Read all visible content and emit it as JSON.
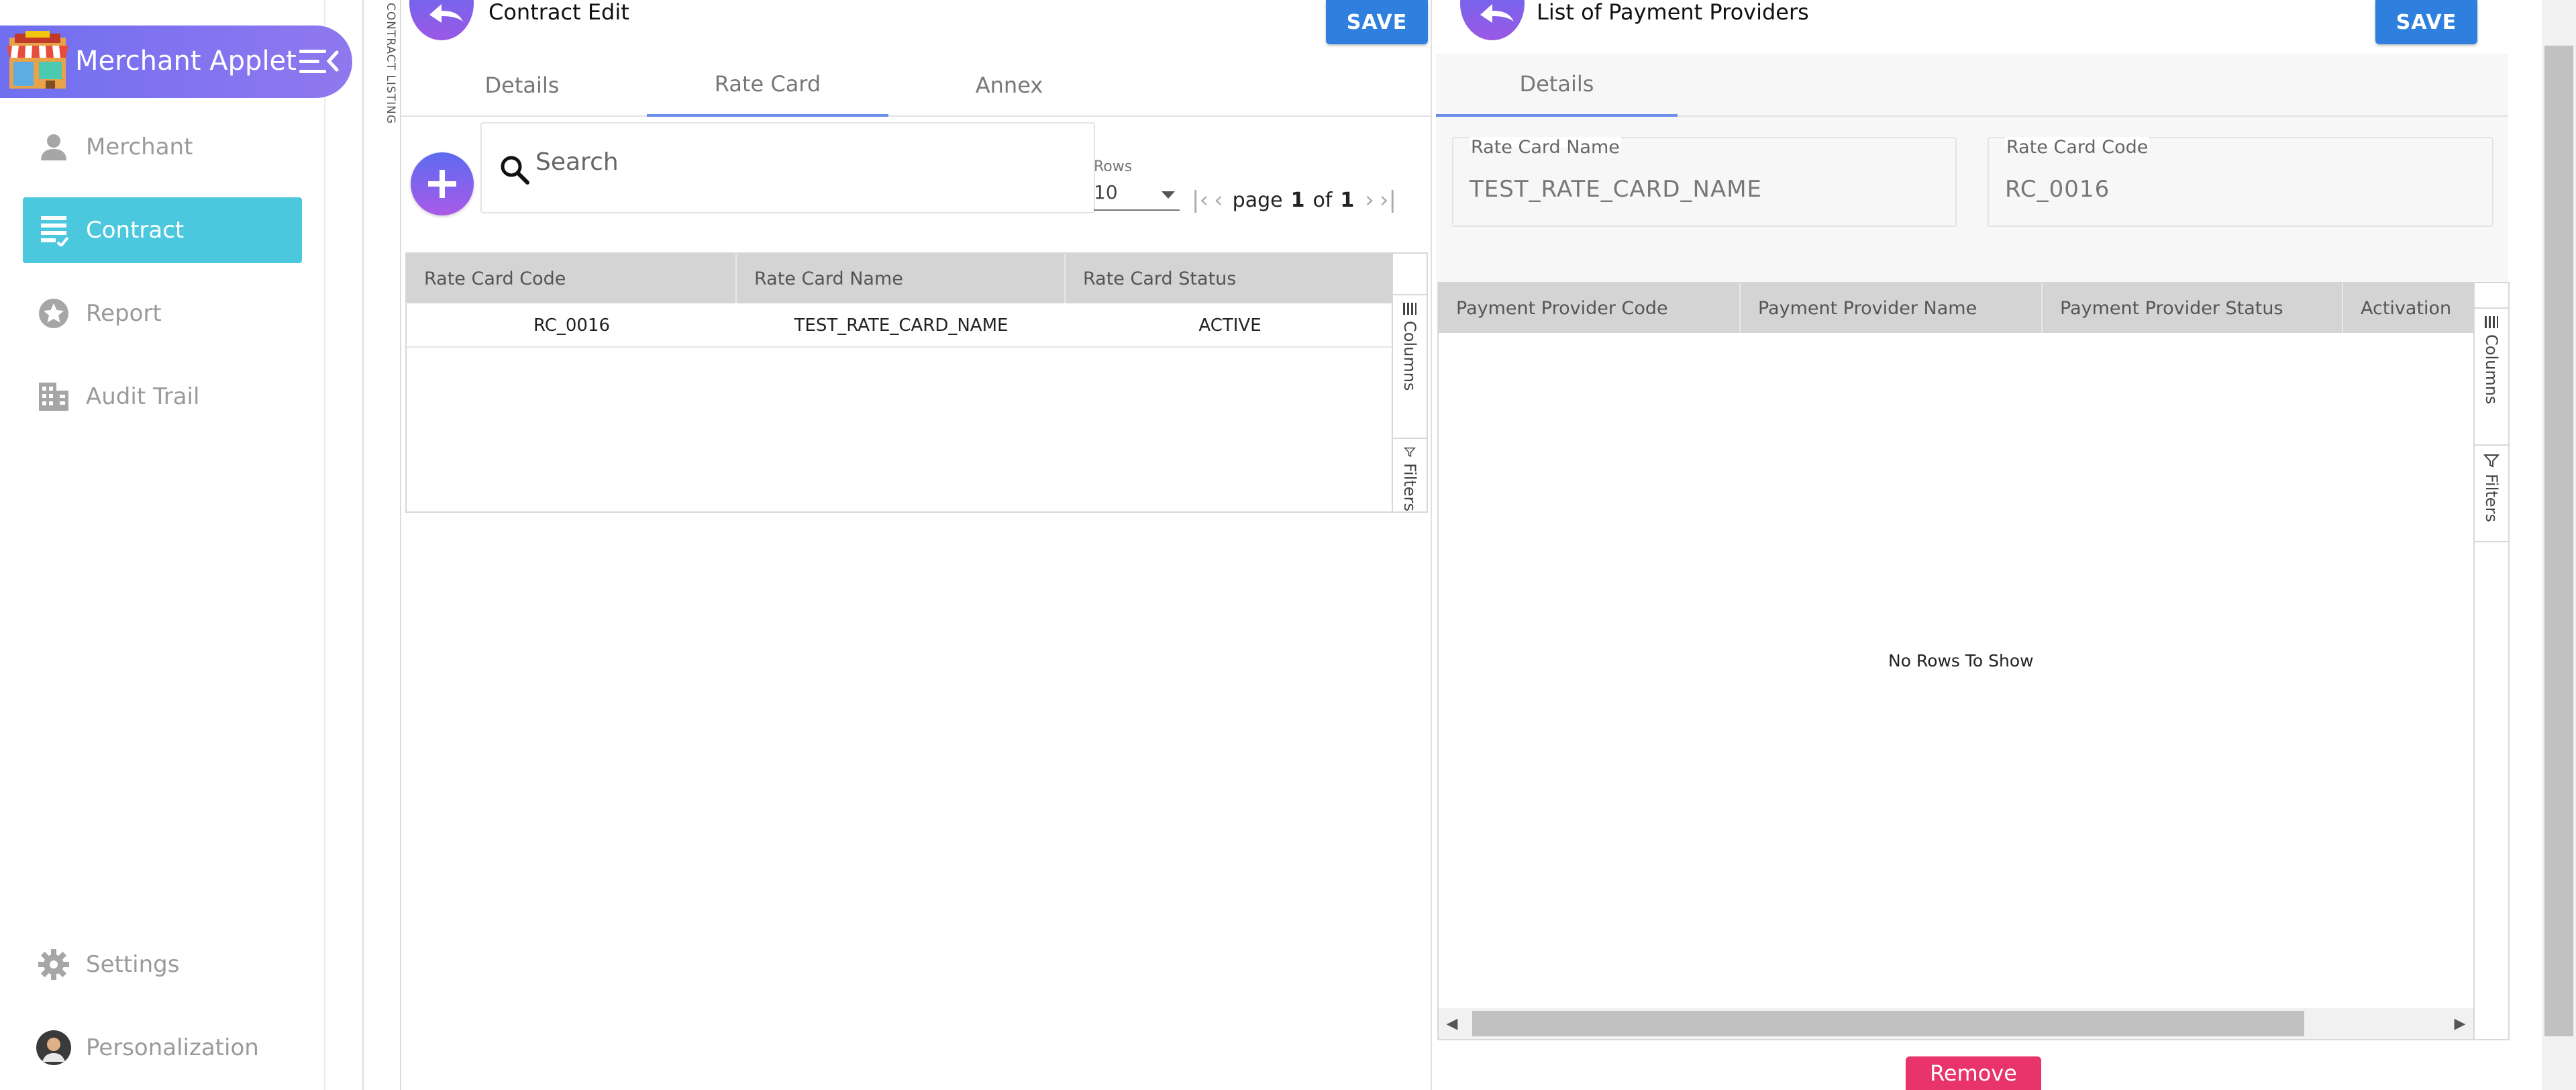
{
  "sidebar": {
    "brand_title": "Merchant Applet",
    "items": [
      {
        "label": "Merchant",
        "icon": "person-icon"
      },
      {
        "label": "Contract",
        "icon": "document-list-icon"
      },
      {
        "label": "Report",
        "icon": "star-badge-icon"
      },
      {
        "label": "Audit Trail",
        "icon": "building-icon"
      }
    ],
    "bottom_items": [
      {
        "label": "Settings",
        "icon": "gear-icon"
      },
      {
        "label": "Personalization",
        "icon": "avatar-icon"
      }
    ],
    "active_color": "#4cc8de"
  },
  "listing_strip": {
    "label": "CONTRACT LISTING"
  },
  "left_panel": {
    "title": "Contract Edit",
    "save_label": "SAVE",
    "tabs": [
      {
        "label": "Details"
      },
      {
        "label": "Rate Card"
      },
      {
        "label": "Annex"
      }
    ],
    "active_tab": "Rate Card",
    "search_placeholder": "Search",
    "rows_label": "Rows",
    "rows_value": "10",
    "pager": {
      "page_word": "page",
      "current": "1",
      "of_word": "of",
      "total": "1"
    },
    "grid": {
      "columns": [
        "Rate Card Code",
        "Rate Card Name",
        "Rate Card Status"
      ],
      "rows": [
        [
          "RC_0016",
          "TEST_RATE_CARD_NAME",
          "ACTIVE"
        ]
      ],
      "side_tools": [
        "Columns",
        "Filters"
      ]
    }
  },
  "right_panel": {
    "title": "List of Payment Providers",
    "save_label": "SAVE",
    "tabs": [
      {
        "label": "Details"
      }
    ],
    "fields": [
      {
        "label": "Rate Card Name",
        "value": "TEST_RATE_CARD_NAME"
      },
      {
        "label": "Rate Card Code",
        "value": "RC_0016"
      }
    ],
    "grid": {
      "columns": [
        "Payment Provider Code",
        "Payment Provider Name",
        "Payment Provider Status",
        "Activation"
      ],
      "empty_text": "No Rows To Show",
      "side_tools": [
        "Columns",
        "Filters"
      ]
    },
    "remove_label": "Remove",
    "remove_color": "#e8336b"
  },
  "colors": {
    "brand_gradient_start": "#6f6ff0",
    "save_button": "#2f80de",
    "tab_underline": "#6b8fe8"
  }
}
